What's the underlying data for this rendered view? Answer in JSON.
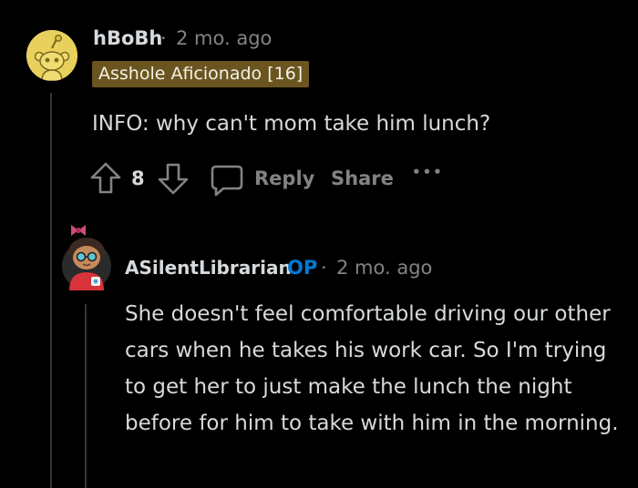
{
  "comment": {
    "author": "hBoBh",
    "separator": "·",
    "timestamp": "2 mo. ago",
    "flair": "Asshole Aficionado [16]",
    "body": "INFO: why can't mom take him lunch?",
    "vote_count": "8",
    "reply_label": "Reply",
    "share_label": "Share",
    "more_label": "•••",
    "avatar_icon": "snoo-avatar-icon",
    "colors": {
      "flair_bg": "#6a5520",
      "avatar_bg": "#e8d05c",
      "background": "#000000",
      "text": "#d7dadc",
      "muted": "#818384"
    }
  },
  "reply": {
    "author": "ASilentLibrarian",
    "op_label": "OP",
    "separator": "·",
    "timestamp": "2 mo. ago",
    "body": "She doesn't feel comfortable driving our other cars when he takes his work car. So I'm trying to get her to just make the lunch the night before for him to take with him in the morning.",
    "avatar_icon": "custom-avatar-icon",
    "colors": {
      "op": "#0079d3"
    }
  }
}
